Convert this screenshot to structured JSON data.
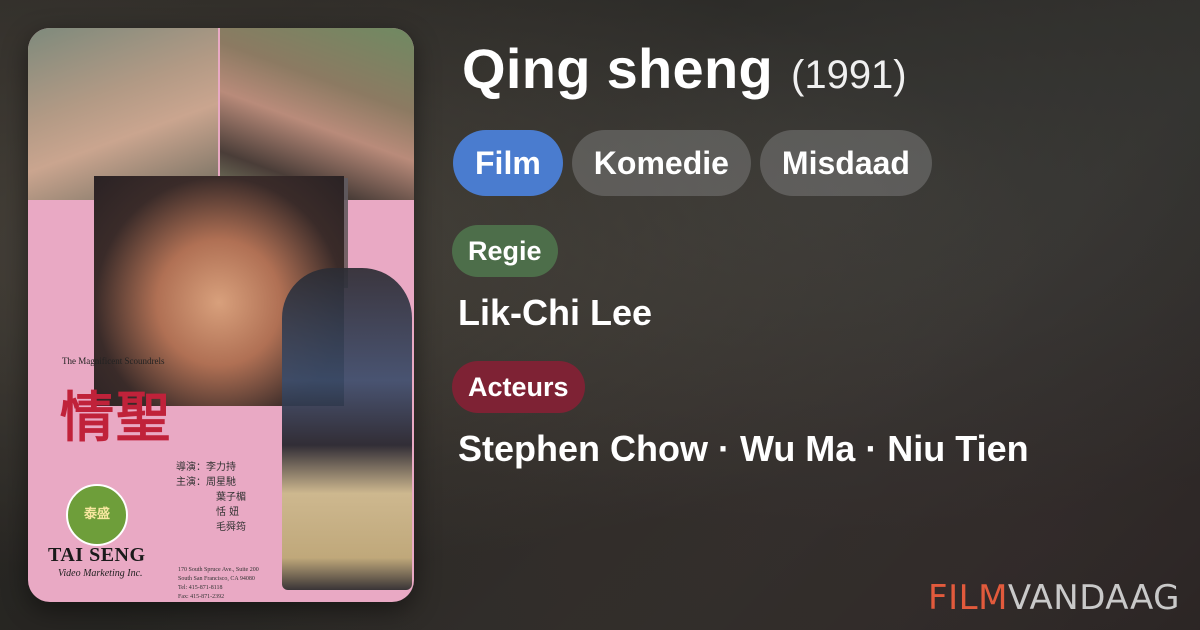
{
  "movie": {
    "title": "Qing sheng",
    "year": "(1991)"
  },
  "genres": [
    "Film",
    "Komedie",
    "Misdaad"
  ],
  "colors": {
    "genre_active": "#4a7ccf",
    "regie_badge": "#4d6e4a",
    "acteurs_badge": "#7e2234",
    "brand_accent": "#e25a3c"
  },
  "regie": {
    "label": "Regie",
    "value": "Lik-Chi Lee"
  },
  "acteurs": {
    "label": "Acteurs",
    "value": "Stephen Chow · Wu Ma · Niu Tien"
  },
  "poster": {
    "english_title": "The Magnificent Scoundrels",
    "chinese_title": "情聖",
    "credits": [
      "導演：李力持",
      "主演：周星馳",
      "葉子楣",
      "恬 妞",
      "毛舜筠"
    ],
    "logo_text": "泰盛",
    "company": "TAI SENG",
    "company_sub": "Video Marketing Inc.",
    "address": [
      "170 South Spruce Ave., Suite 200",
      "South San Francisco, CA 94080",
      "Tel: 415-871-8118",
      "Fax: 415-871-2392"
    ]
  },
  "brand": {
    "part1": "FILM",
    "part2": "VANDAAG"
  }
}
